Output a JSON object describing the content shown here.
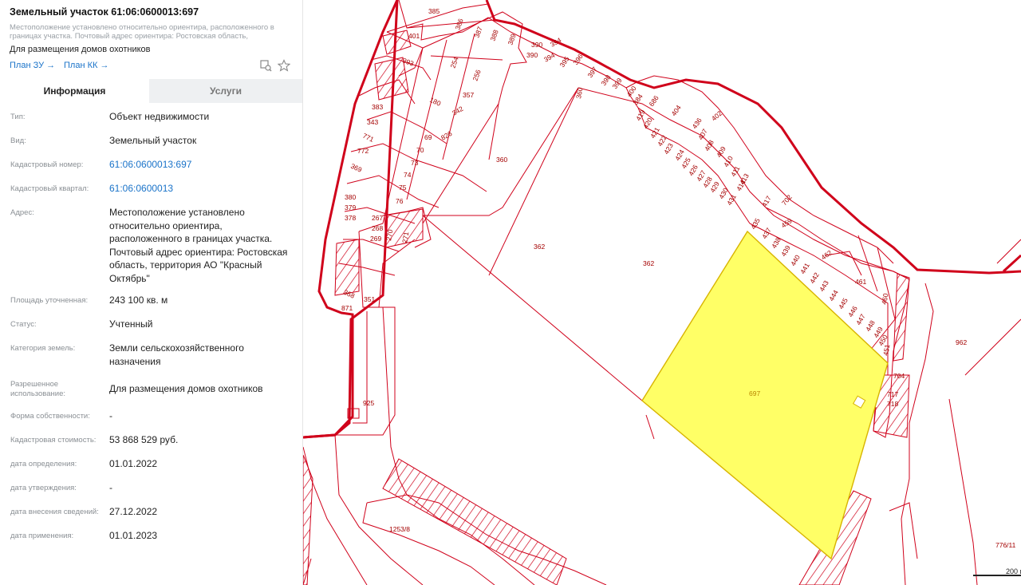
{
  "header": {
    "title": "Земельный участок 61:06:0600013:697",
    "subtitle": "Местоположение установлено относительно ориентира, расположенного в границах участка. Почтовый адрес ориентира: Ростовская область, территори...",
    "purpose": "Для размещения домов охотников",
    "plan_zu": "План ЗУ →",
    "plan_kk": "План КК →"
  },
  "tabs": {
    "info": "Информация",
    "services": "Услуги"
  },
  "info_rows": [
    {
      "label": "Тип:",
      "value": "Объект недвижимости"
    },
    {
      "label": "Вид:",
      "value": "Земельный участок"
    },
    {
      "label": "Кадастровый номер:",
      "value": "61:06:0600013:697"
    },
    {
      "label": "Кадастровый квартал:",
      "value": "61:06:0600013"
    },
    {
      "label": "Адрес:",
      "value": "Местоположение установлено относительно ориентира, расположенного в границах участка. Почтовый адрес ориентира: Ростовская область, территория АО \"Красный Октябрь\""
    },
    {
      "label": "Площадь уточненная:",
      "value": "243 100 кв. м"
    },
    {
      "label": "Статус:",
      "value": "Учтенный"
    },
    {
      "label": "Категория земель:",
      "value": "Земли сельскохозяйственного назначения"
    },
    {
      "label": "Разрешенное использование:",
      "value": "Для размещения домов охотников"
    },
    {
      "label": "Форма собственности:",
      "value": "-"
    },
    {
      "label": "Кадастровая стоимость:",
      "value": "53 868 529 руб."
    },
    {
      "label": "дата определения:",
      "value": "01.01.2022"
    },
    {
      "label": "дата утверждения:",
      "value": "-"
    },
    {
      "label": "дата внесения сведений:",
      "value": "27.12.2022"
    },
    {
      "label": "дата применения:",
      "value": "01.01.2023"
    }
  ],
  "map": {
    "colors": {
      "boundary": "#d0021b",
      "highlight": "#ffff66",
      "highlight_border": "#e0c000"
    },
    "labels": {
      "l385": "385",
      "l386": "386",
      "l387": "387",
      "l388": "388",
      "l389": "389",
      "l390a": "390",
      "l390b": "390",
      "l394a": "394",
      "l394b": "394",
      "l395": "395",
      "l396": "396",
      "l397": "397",
      "l398": "398",
      "l399": "399",
      "l400": "400",
      "l384": "384",
      "l686": "686",
      "l401": "401",
      "l393": "393",
      "l254": "254",
      "l256": "256",
      "l357": "357",
      "l342": "342",
      "l180": "180",
      "l826": "826",
      "l383": "383",
      "l343": "343",
      "l771": "771",
      "l772": "772",
      "l369": "369",
      "l69": "69",
      "l70": "70",
      "l73": "73",
      "l74": "74",
      "l75": "75",
      "l76": "76",
      "l380": "380",
      "l379": "379",
      "l378": "378",
      "l267": "267",
      "l268": "268",
      "l269": "269",
      "l270": "270",
      "l271": "271",
      "l368": "368",
      "l871": "871",
      "l351": "351",
      "l360a": "360",
      "l360b": "360",
      "l362a": "362",
      "l362b": "362",
      "l404": "404",
      "l436": "436",
      "l402": "402",
      "l407": "407",
      "l408": "408",
      "l409": "409",
      "l410": "410",
      "l411": "411",
      "l413": "413",
      "l414": "414",
      "l419": "419",
      "l420": "420",
      "l421": "421",
      "l422": "422",
      "l423": "423",
      "l424": "424",
      "l425": "425",
      "l426": "426",
      "l427": "427",
      "l428": "428",
      "l429": "429",
      "l430": "430",
      "l431": "431",
      "l417": "417",
      "l702": "702",
      "l435": "435",
      "l437": "437",
      "l438": "438",
      "l439": "439",
      "l440": "440",
      "l441": "441",
      "l442": "442",
      "l443": "443",
      "l444": "444",
      "l445": "445",
      "l446": "446",
      "l447": "447",
      "l448": "448",
      "l449": "449",
      "l450": "450",
      "l451": "451",
      "l459": "459",
      "l462": "462",
      "l461": "461",
      "l460": "460",
      "l704": "704",
      "l717": "717",
      "l718": "718",
      "l697": "697",
      "l925": "925",
      "l962": "962",
      "l1253": "1253/8",
      "l776": "776/11"
    },
    "scale": "200 м"
  }
}
